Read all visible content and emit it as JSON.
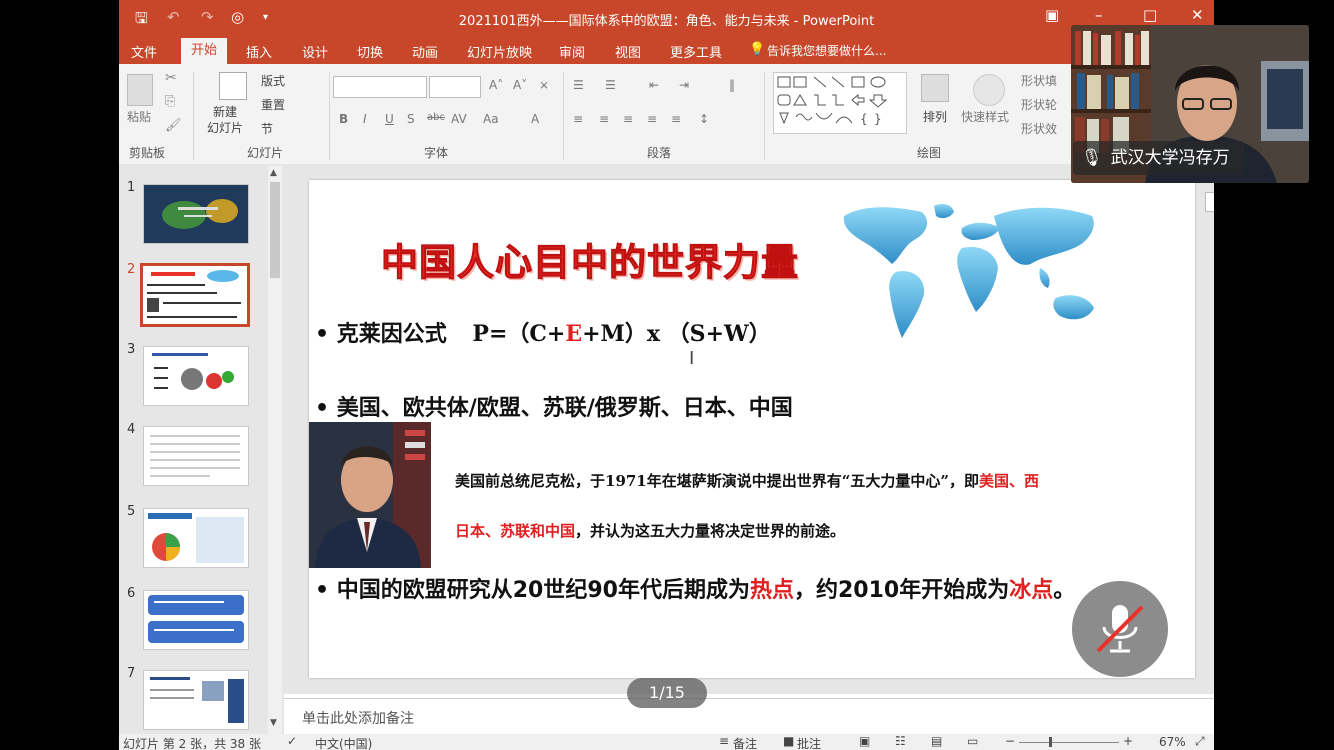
{
  "window": {
    "title": "2021101西外——国际体系中的欧盟：角色、能力与未来 - PowerPoint"
  },
  "ribbon_tabs": [
    "文件",
    "开始",
    "插入",
    "设计",
    "切换",
    "动画",
    "幻灯片放映",
    "审阅",
    "视图",
    "更多工具"
  ],
  "tell_me": "告诉我您想要做什么...",
  "ribbon": {
    "groups": {
      "clipboard": "剪贴板",
      "slides": "幻灯片",
      "font": "字体",
      "paragraph": "段落",
      "drawing": "绘图"
    },
    "paste": "粘贴",
    "new_slide": "新建\n幻灯片",
    "layout": "版式",
    "reset": "重置",
    "section": "节",
    "arrange": "排列",
    "quick_styles": "快速样式",
    "shape_fill": "形状填",
    "shape_outline": "形状轮",
    "shape_effect": "形状效"
  },
  "thumbnails": [
    {
      "num": "1",
      "selected": false
    },
    {
      "num": "2",
      "selected": true
    },
    {
      "num": "3",
      "selected": false
    },
    {
      "num": "4",
      "selected": false
    },
    {
      "num": "5",
      "selected": false
    },
    {
      "num": "6",
      "selected": false
    },
    {
      "num": "7",
      "selected": false
    }
  ],
  "slide": {
    "title": "中国人心目中的世界力量",
    "bullet1_prefix": "•",
    "bullet1_label": "克莱因公式",
    "formula_a": "P=（C+",
    "formula_e": "E",
    "formula_b": "+M）x （S+W）",
    "bullet2": "• 美国、欧共体/欧盟、苏联/俄罗斯、日本、中国",
    "nixon_text_a": "美国前总统尼克松，于1971年在堪萨斯演说中提出世界有“五大力量中心”，即",
    "nixon_red1": "美国、西",
    "nixon_red2": "日本、苏联和中国",
    "nixon_text_b": "，并认为这五大力量将决定世界的前途。",
    "bullet3_a": "• 中国的欧盟研究从20世纪90年代后期成为",
    "bullet3_hot": "热点",
    "bullet3_b": "，约2010年开始成为",
    "bullet3_cold": "冰点",
    "bullet3_c": "。"
  },
  "notes_placeholder": "单击此处添加备注",
  "status": {
    "slide_info": "幻灯片 第 2 张，共 38 张",
    "language": "中文(中国)",
    "notes_btn": "备注",
    "comments_btn": "批注",
    "zoom": "67%"
  },
  "meeting": {
    "participant_name": "武汉大学冯存万",
    "page_indicator": "1/15"
  },
  "colors": {
    "accent": "#c8472a",
    "title_red": "#e8322a"
  }
}
